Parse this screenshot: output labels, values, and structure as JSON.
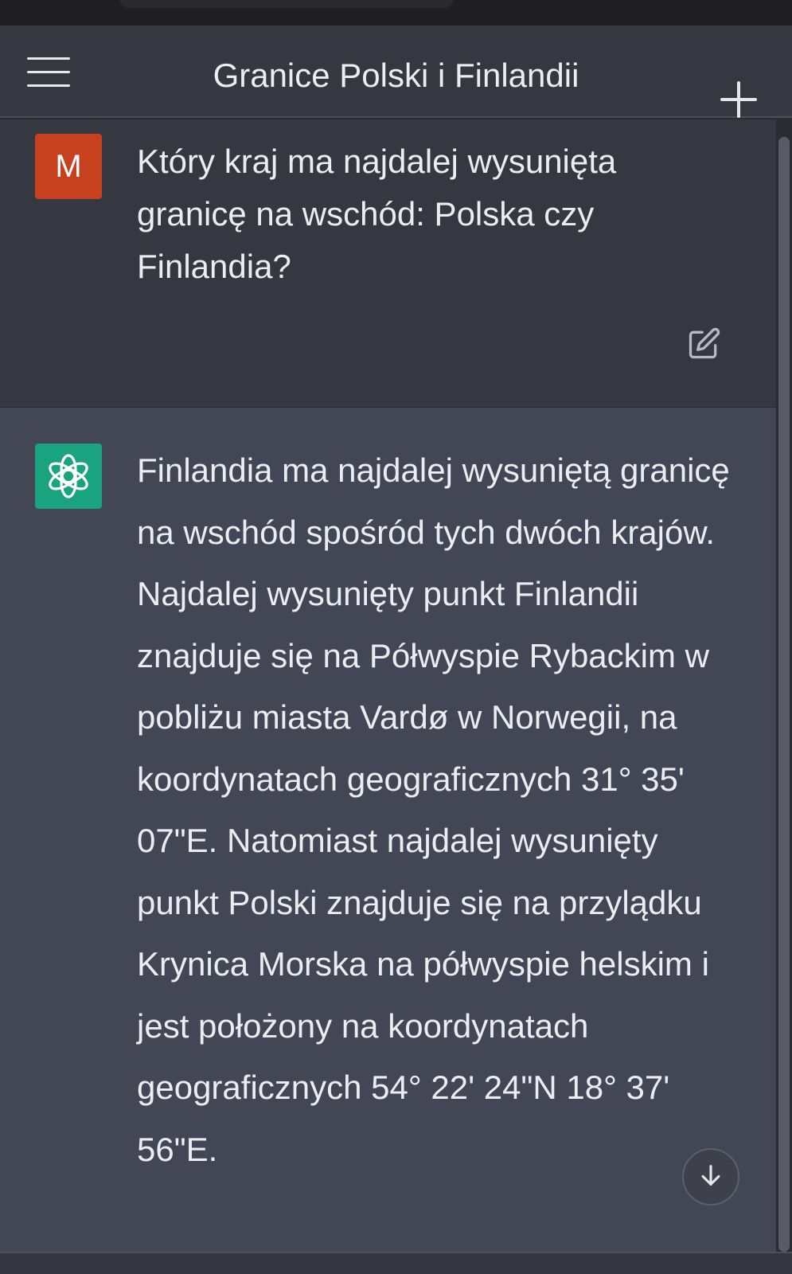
{
  "header": {
    "title": "Granice Polski i Finlandii",
    "menu_icon": "hamburger-menu-icon",
    "new_chat_icon": "plus-icon"
  },
  "conversation": {
    "user": {
      "avatar_letter": "M",
      "avatar_color": "#c8411e",
      "message": "Który kraj ma najdalej wysunięta granicę na wschód: Polska czy Finlandia?",
      "edit_icon": "edit-icon"
    },
    "assistant": {
      "avatar_icon": "openai-logo-icon",
      "avatar_color": "#19a37f",
      "message": "Finlandia ma najdalej wysuniętą granicę na wschód spośród tych dwóch krajów. Najdalej wysunięty punkt Finlandii znajduje się na Półwyspie Rybackim w pobliżu miasta Vardø w Norwegii, na koordynatach geograficznych 31° 35' 07\"E. Natomiast najdalej wysunięty punkt Polski znajduje się na przylądku Krynica Morska na półwyspie helskim i jest położony na koordynatach geograficznych 54° 22' 24\"N 18° 37' 56\"E."
    }
  },
  "scroll_down_icon": "arrow-down-icon",
  "colors": {
    "background": "#2b2c33",
    "user_bg": "#353741",
    "assistant_bg": "#434654",
    "text": "#ececf1"
  }
}
